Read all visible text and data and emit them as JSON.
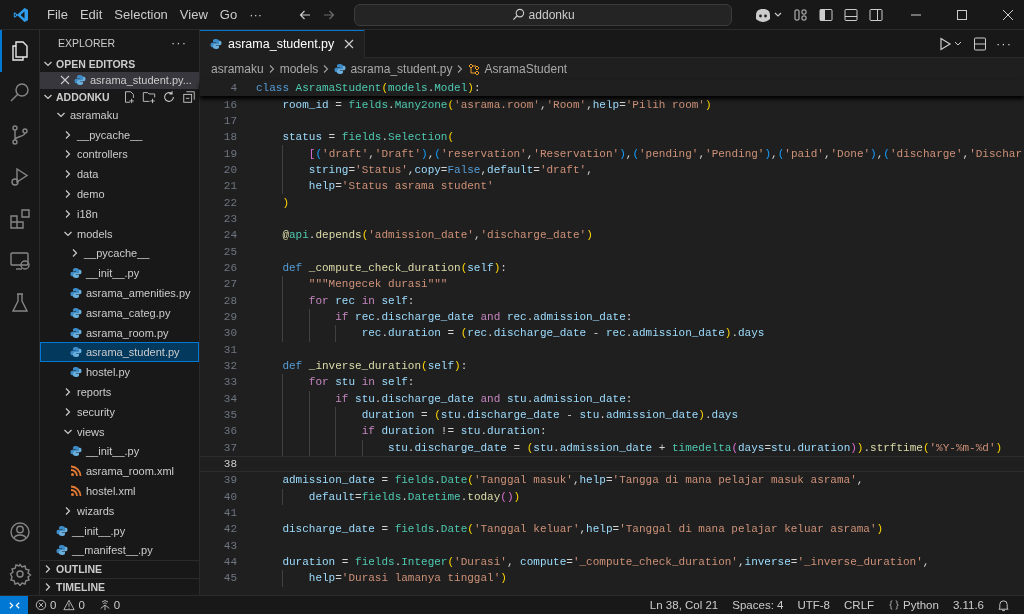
{
  "title_bar": {
    "menu": [
      "File",
      "Edit",
      "Selection",
      "View",
      "Go"
    ],
    "more": "···",
    "search": "addonku"
  },
  "activity_bar": {
    "items": [
      {
        "kind": "explorer",
        "selected": true
      },
      {
        "kind": "search",
        "selected": false
      },
      {
        "kind": "source-control",
        "selected": false
      },
      {
        "kind": "run-debug",
        "selected": false
      },
      {
        "kind": "extensions",
        "selected": false
      },
      {
        "kind": "remote",
        "selected": false
      },
      {
        "kind": "testing",
        "selected": false
      }
    ],
    "bottom": [
      {
        "kind": "account"
      },
      {
        "kind": "settings"
      }
    ]
  },
  "explorer": {
    "title": "EXPLORER",
    "more": "···",
    "open_editors": {
      "label": "OPEN EDITORS",
      "expanded": true,
      "items": [
        {
          "label": "asrama_student.py...",
          "kind": "py",
          "selected": true
        }
      ]
    },
    "folder": {
      "label": "ADDONKU",
      "expanded": true,
      "tree": [
        {
          "label": "asramaku",
          "kind": "folder",
          "expanded": true,
          "selected": false,
          "children": [
            {
              "label": "__pycache__",
              "kind": "folder",
              "expanded": false,
              "selected": false
            },
            {
              "label": "controllers",
              "kind": "folder",
              "expanded": false,
              "selected": false
            },
            {
              "label": "data",
              "kind": "folder",
              "expanded": false,
              "selected": false
            },
            {
              "label": "demo",
              "kind": "folder",
              "expanded": false,
              "selected": false
            },
            {
              "label": "i18n",
              "kind": "folder",
              "expanded": false,
              "selected": false
            },
            {
              "label": "models",
              "kind": "folder",
              "expanded": true,
              "selected": false,
              "children": [
                {
                  "label": "__pycache__",
                  "kind": "folder",
                  "expanded": false,
                  "selected": false
                },
                {
                  "label": "__init__.py",
                  "kind": "py",
                  "selected": false
                },
                {
                  "label": "asrama_amenities.py",
                  "kind": "py",
                  "selected": false
                },
                {
                  "label": "asrama_categ.py",
                  "kind": "py",
                  "selected": false
                },
                {
                  "label": "asrama_room.py",
                  "kind": "py",
                  "selected": false
                },
                {
                  "label": "asrama_student.py",
                  "kind": "py",
                  "selected": true
                },
                {
                  "label": "hostel.py",
                  "kind": "py",
                  "selected": false
                }
              ]
            },
            {
              "label": "reports",
              "kind": "folder",
              "expanded": false,
              "selected": false
            },
            {
              "label": "security",
              "kind": "folder",
              "expanded": false,
              "selected": false
            },
            {
              "label": "views",
              "kind": "folder",
              "expanded": true,
              "selected": false,
              "children": [
                {
                  "label": "__init__.py",
                  "kind": "py",
                  "selected": false
                },
                {
                  "label": "asrama_room.xml",
                  "kind": "xml",
                  "selected": false
                },
                {
                  "label": "hostel.xml",
                  "kind": "xml",
                  "selected": false
                }
              ]
            },
            {
              "label": "wizards",
              "kind": "folder",
              "expanded": false,
              "selected": false
            }
          ]
        },
        {
          "label": "__init__.py",
          "kind": "py",
          "selected": false
        },
        {
          "label": "__manifest__.py",
          "kind": "py",
          "selected": false
        }
      ]
    },
    "panels": [
      {
        "label": "OUTLINE",
        "expanded": false
      },
      {
        "label": "TIMELINE",
        "expanded": false
      }
    ]
  },
  "editor": {
    "tabs": [
      {
        "label": "asrama_student.py",
        "kind": "py",
        "selected": true
      }
    ],
    "toolbar_more": "···",
    "breadcrumb": [
      {
        "label": "asramaku",
        "kind": "folder"
      },
      {
        "label": "models",
        "kind": "folder"
      },
      {
        "label": "asrama_student.py",
        "kind": "py"
      },
      {
        "label": "AsramaStudent",
        "kind": "class"
      }
    ],
    "sticky_lines": [
      {
        "number": "4",
        "tokens": [
          {
            "text": "class ",
            "kind": "keyword"
          },
          {
            "text": "AsramaStudent",
            "kind": "class"
          },
          {
            "text": "(",
            "kind": "bracket1"
          },
          {
            "text": "models",
            "kind": "class"
          },
          {
            "text": ".",
            "kind": "plain"
          },
          {
            "text": "Model",
            "kind": "class"
          },
          {
            "text": ")",
            "kind": "bracket1"
          },
          {
            "text": ":",
            "kind": "plain"
          }
        ]
      }
    ],
    "lines": [
      {
        "number": "16",
        "current": false,
        "tokens": [
          {
            "text": "    room_id",
            "kind": "variable"
          },
          {
            "text": " = ",
            "kind": "plain"
          },
          {
            "text": "fields",
            "kind": "class"
          },
          {
            "text": ".",
            "kind": "plain"
          },
          {
            "text": "Many2one",
            "kind": "class"
          },
          {
            "text": "(",
            "kind": "bracket1"
          },
          {
            "text": "'asrama.room'",
            "kind": "string"
          },
          {
            "text": ",",
            "kind": "plain"
          },
          {
            "text": "'Room'",
            "kind": "string"
          },
          {
            "text": ",",
            "kind": "plain"
          },
          {
            "text": "help",
            "kind": "variable"
          },
          {
            "text": "=",
            "kind": "plain"
          },
          {
            "text": "'Pilih room'",
            "kind": "string"
          },
          {
            "text": ")",
            "kind": "bracket1"
          }
        ]
      },
      {
        "number": "17",
        "current": false
      },
      {
        "number": "18",
        "current": false,
        "tokens": [
          {
            "text": "    status",
            "kind": "variable"
          },
          {
            "text": " = ",
            "kind": "plain"
          },
          {
            "text": "fields",
            "kind": "class"
          },
          {
            "text": ".",
            "kind": "plain"
          },
          {
            "text": "Selection",
            "kind": "class"
          },
          {
            "text": "(",
            "kind": "bracket1"
          }
        ]
      },
      {
        "number": "19",
        "current": false,
        "tokens": [
          {
            "text": "        [",
            "kind": "bracket2"
          },
          {
            "text": "(",
            "kind": "bracket3"
          },
          {
            "text": "'draft'",
            "kind": "string"
          },
          {
            "text": ",",
            "kind": "plain"
          },
          {
            "text": "'Draft'",
            "kind": "string"
          },
          {
            "text": ")",
            "kind": "bracket3"
          },
          {
            "text": ",",
            "kind": "plain"
          },
          {
            "text": "(",
            "kind": "bracket3"
          },
          {
            "text": "'reservation'",
            "kind": "string"
          },
          {
            "text": ",",
            "kind": "plain"
          },
          {
            "text": "'Reservation'",
            "kind": "string"
          },
          {
            "text": ")",
            "kind": "bracket3"
          },
          {
            "text": ",",
            "kind": "plain"
          },
          {
            "text": "(",
            "kind": "bracket3"
          },
          {
            "text": "'pending'",
            "kind": "string"
          },
          {
            "text": ",",
            "kind": "plain"
          },
          {
            "text": "'Pending'",
            "kind": "string"
          },
          {
            "text": ")",
            "kind": "bracket3"
          },
          {
            "text": ",",
            "kind": "plain"
          },
          {
            "text": "(",
            "kind": "bracket3"
          },
          {
            "text": "'paid'",
            "kind": "string"
          },
          {
            "text": ",",
            "kind": "plain"
          },
          {
            "text": "'Done'",
            "kind": "string"
          },
          {
            "text": ")",
            "kind": "bracket3"
          },
          {
            "text": ",",
            "kind": "plain"
          },
          {
            "text": "(",
            "kind": "bracket3"
          },
          {
            "text": "'discharge'",
            "kind": "string"
          },
          {
            "text": ",",
            "kind": "plain"
          },
          {
            "text": "'Dischar",
            "kind": "string"
          }
        ]
      },
      {
        "number": "20",
        "current": false,
        "tokens": [
          {
            "text": "        string",
            "kind": "variable"
          },
          {
            "text": "=",
            "kind": "plain"
          },
          {
            "text": "'Status'",
            "kind": "string"
          },
          {
            "text": ",",
            "kind": "plain"
          },
          {
            "text": "copy",
            "kind": "variable"
          },
          {
            "text": "=",
            "kind": "plain"
          },
          {
            "text": "False",
            "kind": "keyword"
          },
          {
            "text": ",",
            "kind": "plain"
          },
          {
            "text": "default",
            "kind": "variable"
          },
          {
            "text": "=",
            "kind": "plain"
          },
          {
            "text": "'draft'",
            "kind": "string"
          },
          {
            "text": ",",
            "kind": "plain"
          }
        ]
      },
      {
        "number": "21",
        "current": false,
        "tokens": [
          {
            "text": "        help",
            "kind": "variable"
          },
          {
            "text": "=",
            "kind": "plain"
          },
          {
            "text": "'Status asrama student'",
            "kind": "string"
          }
        ]
      },
      {
        "number": "22",
        "current": false,
        "tokens": [
          {
            "text": "    )",
            "kind": "bracket1"
          }
        ]
      },
      {
        "number": "23",
        "current": false
      },
      {
        "number": "24",
        "current": false,
        "tokens": [
          {
            "text": "    @",
            "kind": "function"
          },
          {
            "text": "api",
            "kind": "class"
          },
          {
            "text": ".",
            "kind": "plain"
          },
          {
            "text": "depends",
            "kind": "function"
          },
          {
            "text": "(",
            "kind": "bracket1"
          },
          {
            "text": "'admission_date'",
            "kind": "string"
          },
          {
            "text": ",",
            "kind": "plain"
          },
          {
            "text": "'discharge_date'",
            "kind": "string"
          },
          {
            "text": ")",
            "kind": "bracket1"
          }
        ]
      },
      {
        "number": "25",
        "current": false
      },
      {
        "number": "26",
        "current": false,
        "tokens": [
          {
            "text": "    def ",
            "kind": "keyword"
          },
          {
            "text": "_compute_check_duration",
            "kind": "function"
          },
          {
            "text": "(",
            "kind": "bracket1"
          },
          {
            "text": "self",
            "kind": "variable"
          },
          {
            "text": ")",
            "kind": "bracket1"
          },
          {
            "text": ":",
            "kind": "plain"
          }
        ]
      },
      {
        "number": "27",
        "current": false,
        "tokens": [
          {
            "text": "        \"\"\"Mengecek durasi\"\"\"",
            "kind": "string"
          }
        ]
      },
      {
        "number": "28",
        "current": false,
        "tokens": [
          {
            "text": "        for ",
            "kind": "control"
          },
          {
            "text": "rec",
            "kind": "variable"
          },
          {
            "text": " in ",
            "kind": "control"
          },
          {
            "text": "self",
            "kind": "variable"
          },
          {
            "text": ":",
            "kind": "plain"
          }
        ]
      },
      {
        "number": "29",
        "current": false,
        "tokens": [
          {
            "text": "            if ",
            "kind": "control"
          },
          {
            "text": "rec",
            "kind": "variable"
          },
          {
            "text": ".",
            "kind": "plain"
          },
          {
            "text": "discharge_date",
            "kind": "variable"
          },
          {
            "text": " and ",
            "kind": "control"
          },
          {
            "text": "rec",
            "kind": "variable"
          },
          {
            "text": ".",
            "kind": "plain"
          },
          {
            "text": "admission_date",
            "kind": "variable"
          },
          {
            "text": ":",
            "kind": "plain"
          }
        ]
      },
      {
        "number": "30",
        "current": false,
        "tokens": [
          {
            "text": "                rec",
            "kind": "variable"
          },
          {
            "text": ".",
            "kind": "plain"
          },
          {
            "text": "duration",
            "kind": "variable"
          },
          {
            "text": " = ",
            "kind": "plain"
          },
          {
            "text": "(",
            "kind": "bracket1"
          },
          {
            "text": "rec",
            "kind": "variable"
          },
          {
            "text": ".",
            "kind": "plain"
          },
          {
            "text": "discharge_date",
            "kind": "variable"
          },
          {
            "text": " - ",
            "kind": "plain"
          },
          {
            "text": "rec",
            "kind": "variable"
          },
          {
            "text": ".",
            "kind": "plain"
          },
          {
            "text": "admission_date",
            "kind": "variable"
          },
          {
            "text": ")",
            "kind": "bracket1"
          },
          {
            "text": ".",
            "kind": "plain"
          },
          {
            "text": "days",
            "kind": "variable"
          }
        ]
      },
      {
        "number": "31",
        "current": false
      },
      {
        "number": "32",
        "current": false,
        "tokens": [
          {
            "text": "    def ",
            "kind": "keyword"
          },
          {
            "text": "_inverse_duration",
            "kind": "function"
          },
          {
            "text": "(",
            "kind": "bracket1"
          },
          {
            "text": "self",
            "kind": "variable"
          },
          {
            "text": ")",
            "kind": "bracket1"
          },
          {
            "text": ":",
            "kind": "plain"
          }
        ]
      },
      {
        "number": "33",
        "current": false,
        "tokens": [
          {
            "text": "        for ",
            "kind": "control"
          },
          {
            "text": "stu",
            "kind": "variable"
          },
          {
            "text": " in ",
            "kind": "control"
          },
          {
            "text": "self",
            "kind": "variable"
          },
          {
            "text": ":",
            "kind": "plain"
          }
        ]
      },
      {
        "number": "34",
        "current": false,
        "tokens": [
          {
            "text": "            if ",
            "kind": "control"
          },
          {
            "text": "stu",
            "kind": "variable"
          },
          {
            "text": ".",
            "kind": "plain"
          },
          {
            "text": "discharge_date",
            "kind": "variable"
          },
          {
            "text": " and ",
            "kind": "control"
          },
          {
            "text": "stu",
            "kind": "variable"
          },
          {
            "text": ".",
            "kind": "plain"
          },
          {
            "text": "admission_date",
            "kind": "variable"
          },
          {
            "text": ":",
            "kind": "plain"
          }
        ]
      },
      {
        "number": "35",
        "current": false,
        "tokens": [
          {
            "text": "                duration",
            "kind": "variable"
          },
          {
            "text": " = ",
            "kind": "plain"
          },
          {
            "text": "(",
            "kind": "bracket1"
          },
          {
            "text": "stu",
            "kind": "variable"
          },
          {
            "text": ".",
            "kind": "plain"
          },
          {
            "text": "discharge_date",
            "kind": "variable"
          },
          {
            "text": " - ",
            "kind": "plain"
          },
          {
            "text": "stu",
            "kind": "variable"
          },
          {
            "text": ".",
            "kind": "plain"
          },
          {
            "text": "admission_date",
            "kind": "variable"
          },
          {
            "text": ")",
            "kind": "bracket1"
          },
          {
            "text": ".",
            "kind": "plain"
          },
          {
            "text": "days",
            "kind": "variable"
          }
        ]
      },
      {
        "number": "36",
        "current": false,
        "tokens": [
          {
            "text": "                if ",
            "kind": "control"
          },
          {
            "text": "duration",
            "kind": "variable"
          },
          {
            "text": " != ",
            "kind": "plain"
          },
          {
            "text": "stu",
            "kind": "variable"
          },
          {
            "text": ".",
            "kind": "plain"
          },
          {
            "text": "duration",
            "kind": "variable"
          },
          {
            "text": ":",
            "kind": "plain"
          }
        ]
      },
      {
        "number": "37",
        "current": false,
        "tokens": [
          {
            "text": "                    stu",
            "kind": "variable"
          },
          {
            "text": ".",
            "kind": "plain"
          },
          {
            "text": "discharge_date",
            "kind": "variable"
          },
          {
            "text": " = ",
            "kind": "plain"
          },
          {
            "text": "(",
            "kind": "bracket1"
          },
          {
            "text": "stu",
            "kind": "variable"
          },
          {
            "text": ".",
            "kind": "plain"
          },
          {
            "text": "admission_date",
            "kind": "variable"
          },
          {
            "text": " + ",
            "kind": "plain"
          },
          {
            "text": "timedelta",
            "kind": "class"
          },
          {
            "text": "(",
            "kind": "bracket2"
          },
          {
            "text": "days",
            "kind": "variable"
          },
          {
            "text": "=",
            "kind": "plain"
          },
          {
            "text": "stu",
            "kind": "variable"
          },
          {
            "text": ".",
            "kind": "plain"
          },
          {
            "text": "duration",
            "kind": "variable"
          },
          {
            "text": ")",
            "kind": "bracket2"
          },
          {
            "text": ")",
            "kind": "bracket1"
          },
          {
            "text": ".",
            "kind": "plain"
          },
          {
            "text": "strftime",
            "kind": "function"
          },
          {
            "text": "(",
            "kind": "bracket1"
          },
          {
            "text": "'%Y-%m-%d'",
            "kind": "string"
          },
          {
            "text": ")",
            "kind": "bracket1"
          }
        ]
      },
      {
        "number": "38",
        "current": true
      },
      {
        "number": "39",
        "current": false,
        "tokens": [
          {
            "text": "    admission_date",
            "kind": "variable"
          },
          {
            "text": " = ",
            "kind": "plain"
          },
          {
            "text": "fields",
            "kind": "class"
          },
          {
            "text": ".",
            "kind": "plain"
          },
          {
            "text": "Date",
            "kind": "class"
          },
          {
            "text": "(",
            "kind": "bracket1"
          },
          {
            "text": "'Tanggal masuk'",
            "kind": "string"
          },
          {
            "text": ",",
            "kind": "plain"
          },
          {
            "text": "help",
            "kind": "variable"
          },
          {
            "text": "=",
            "kind": "plain"
          },
          {
            "text": "'Tangga di mana pelajar masuk asrama'",
            "kind": "string"
          },
          {
            "text": ",",
            "kind": "plain"
          }
        ]
      },
      {
        "number": "40",
        "current": false,
        "tokens": [
          {
            "text": "        default",
            "kind": "variable"
          },
          {
            "text": "=",
            "kind": "plain"
          },
          {
            "text": "fields",
            "kind": "class"
          },
          {
            "text": ".",
            "kind": "plain"
          },
          {
            "text": "Datetime",
            "kind": "class"
          },
          {
            "text": ".",
            "kind": "plain"
          },
          {
            "text": "today",
            "kind": "function"
          },
          {
            "text": "(",
            "kind": "bracket2"
          },
          {
            "text": ")",
            "kind": "bracket2"
          },
          {
            "text": ")",
            "kind": "bracket1"
          }
        ]
      },
      {
        "number": "41",
        "current": false
      },
      {
        "number": "42",
        "current": false,
        "tokens": [
          {
            "text": "    discharge_date",
            "kind": "variable"
          },
          {
            "text": " = ",
            "kind": "plain"
          },
          {
            "text": "fields",
            "kind": "class"
          },
          {
            "text": ".",
            "kind": "plain"
          },
          {
            "text": "Date",
            "kind": "class"
          },
          {
            "text": "(",
            "kind": "bracket1"
          },
          {
            "text": "'Tanggal keluar'",
            "kind": "string"
          },
          {
            "text": ",",
            "kind": "plain"
          },
          {
            "text": "help",
            "kind": "variable"
          },
          {
            "text": "=",
            "kind": "plain"
          },
          {
            "text": "'Tanggal di mana pelajar keluar asrama'",
            "kind": "string"
          },
          {
            "text": ")",
            "kind": "bracket1"
          }
        ]
      },
      {
        "number": "43",
        "current": false
      },
      {
        "number": "44",
        "current": false,
        "tokens": [
          {
            "text": "    duration",
            "kind": "variable"
          },
          {
            "text": " = ",
            "kind": "plain"
          },
          {
            "text": "fields",
            "kind": "class"
          },
          {
            "text": ".",
            "kind": "plain"
          },
          {
            "text": "Integer",
            "kind": "class"
          },
          {
            "text": "(",
            "kind": "bracket1"
          },
          {
            "text": "'Durasi'",
            "kind": "string"
          },
          {
            "text": ", ",
            "kind": "plain"
          },
          {
            "text": "compute",
            "kind": "variable"
          },
          {
            "text": "=",
            "kind": "plain"
          },
          {
            "text": "'_compute_check_duration'",
            "kind": "string"
          },
          {
            "text": ",",
            "kind": "plain"
          },
          {
            "text": "inverse",
            "kind": "variable"
          },
          {
            "text": "=",
            "kind": "plain"
          },
          {
            "text": "'_inverse_duration'",
            "kind": "string"
          },
          {
            "text": ",",
            "kind": "plain"
          }
        ]
      },
      {
        "number": "45",
        "current": false,
        "tokens": [
          {
            "text": "        help",
            "kind": "variable"
          },
          {
            "text": "=",
            "kind": "plain"
          },
          {
            "text": "'Durasi lamanya tinggal'",
            "kind": "string"
          },
          {
            "text": ")",
            "kind": "bracket1"
          }
        ]
      }
    ]
  },
  "status_bar": {
    "errors": "0",
    "warnings": "0",
    "ports": "0",
    "items": [
      {
        "label": "Ln 38, Col 21",
        "kind": "text"
      },
      {
        "label": "Spaces: 4",
        "kind": "text"
      },
      {
        "label": "UTF-8",
        "kind": "text"
      },
      {
        "label": "CRLF",
        "kind": "text"
      },
      {
        "label": "Python",
        "kind": "language"
      },
      {
        "label": "3.11.6",
        "kind": "text"
      }
    ]
  }
}
